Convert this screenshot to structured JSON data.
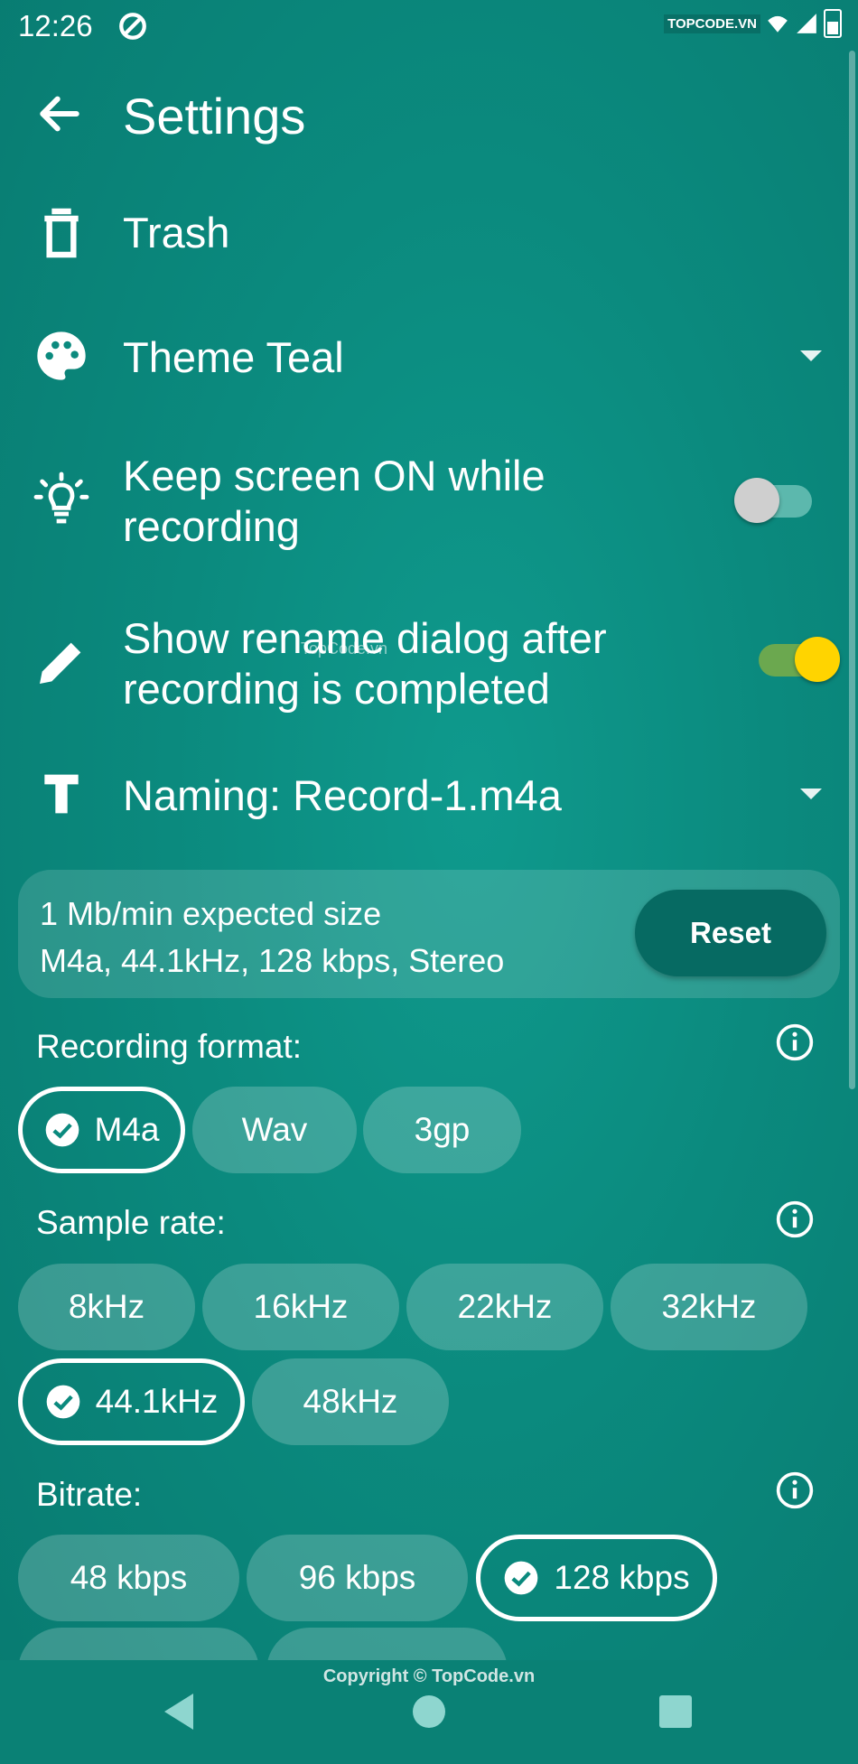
{
  "status_bar": {
    "time": "12:26",
    "watermark": "TOPCODE.VN"
  },
  "header": {
    "title": "Settings"
  },
  "rows": {
    "trash": {
      "label": "Trash"
    },
    "theme": {
      "label": "Theme Teal"
    },
    "keep_screen": {
      "label_line1": "Keep screen ON while",
      "label_line2": "recording",
      "enabled": false
    },
    "rename_dialog": {
      "label_line1": "Show rename dialog after",
      "label_line2": "recording is completed",
      "enabled": true
    },
    "naming": {
      "label": "Naming: Record-1.m4a"
    }
  },
  "info_card": {
    "line1": "1 Mb/min expected size",
    "line2": "M4a, 44.1kHz, 128 kbps, Stereo",
    "reset_label": "Reset"
  },
  "recording_format": {
    "label": "Recording format:",
    "options": [
      "M4a",
      "Wav",
      "3gp"
    ],
    "selected": "M4a"
  },
  "sample_rate": {
    "label": "Sample rate:",
    "options": [
      "8kHz",
      "16kHz",
      "22kHz",
      "32kHz",
      "44.1kHz",
      "48kHz"
    ],
    "selected": "44.1kHz"
  },
  "bitrate": {
    "label": "Bitrate:",
    "options": [
      "48 kbps",
      "96 kbps",
      "128 kbps"
    ],
    "selected": "128 kbps"
  },
  "watermark_center": "TopCode.vn",
  "footer": {
    "copyright": "Copyright © TopCode.vn"
  },
  "colors": {
    "background": "#0b8a7e",
    "toggle_on_knob": "#ffd400",
    "reset_button": "#066a62"
  }
}
